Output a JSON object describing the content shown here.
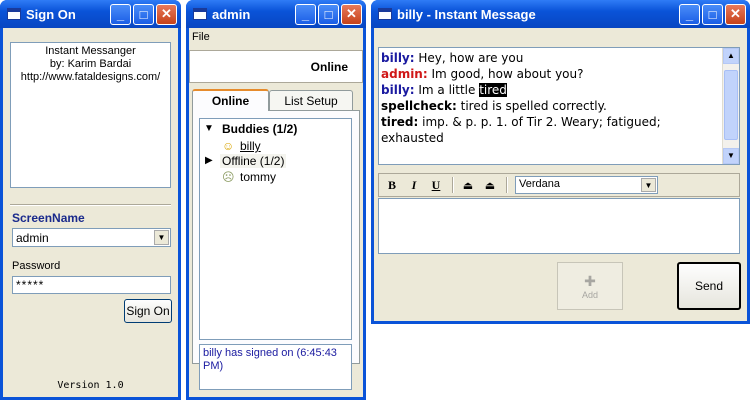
{
  "signon": {
    "title": "Sign On",
    "credits": [
      "Instant Messanger",
      "by: Karim Bardai",
      "http://www.fataldesigns.com/"
    ],
    "screenname_label": "ScreenName",
    "screenname_value": "admin",
    "password_label": "Password",
    "password_value": "*****",
    "signon_button": "Sign On",
    "version": "Version 1.0"
  },
  "buddy": {
    "title": "admin",
    "menu_file": "File",
    "status": "Online",
    "tabs": [
      "Online",
      "List Setup"
    ],
    "group_buddies": "Buddies (1/2)",
    "buddy_online": "billy",
    "group_offline": "Offline (1/2)",
    "buddy_offline": "tommy",
    "status_log": "billy has signed on (6:45:43 PM)"
  },
  "im": {
    "title": "billy - Instant Message",
    "messages": [
      {
        "sender": "billy:",
        "text": " Hey, how are you",
        "color": "#1a1aa0"
      },
      {
        "sender": "admin:",
        "text": " Im good, how about you?",
        "color": "#d01818"
      },
      {
        "sender": "billy:",
        "text": " Im a little ",
        "highlight": "tired",
        "color": "#1a1aa0"
      },
      {
        "sender": "spellcheck:",
        "text": " tired is spelled correctly.",
        "color": "#000000"
      },
      {
        "sender": "tired:",
        "text": " imp. & p. p. 1. of Tir 2. Weary; fatigued; exhausted",
        "color": "#000000"
      }
    ],
    "bold_label": "B",
    "italic_label": "I",
    "underline_label": "U",
    "font_value": "Verdana",
    "add_label": "Add",
    "send_label": "Send"
  }
}
